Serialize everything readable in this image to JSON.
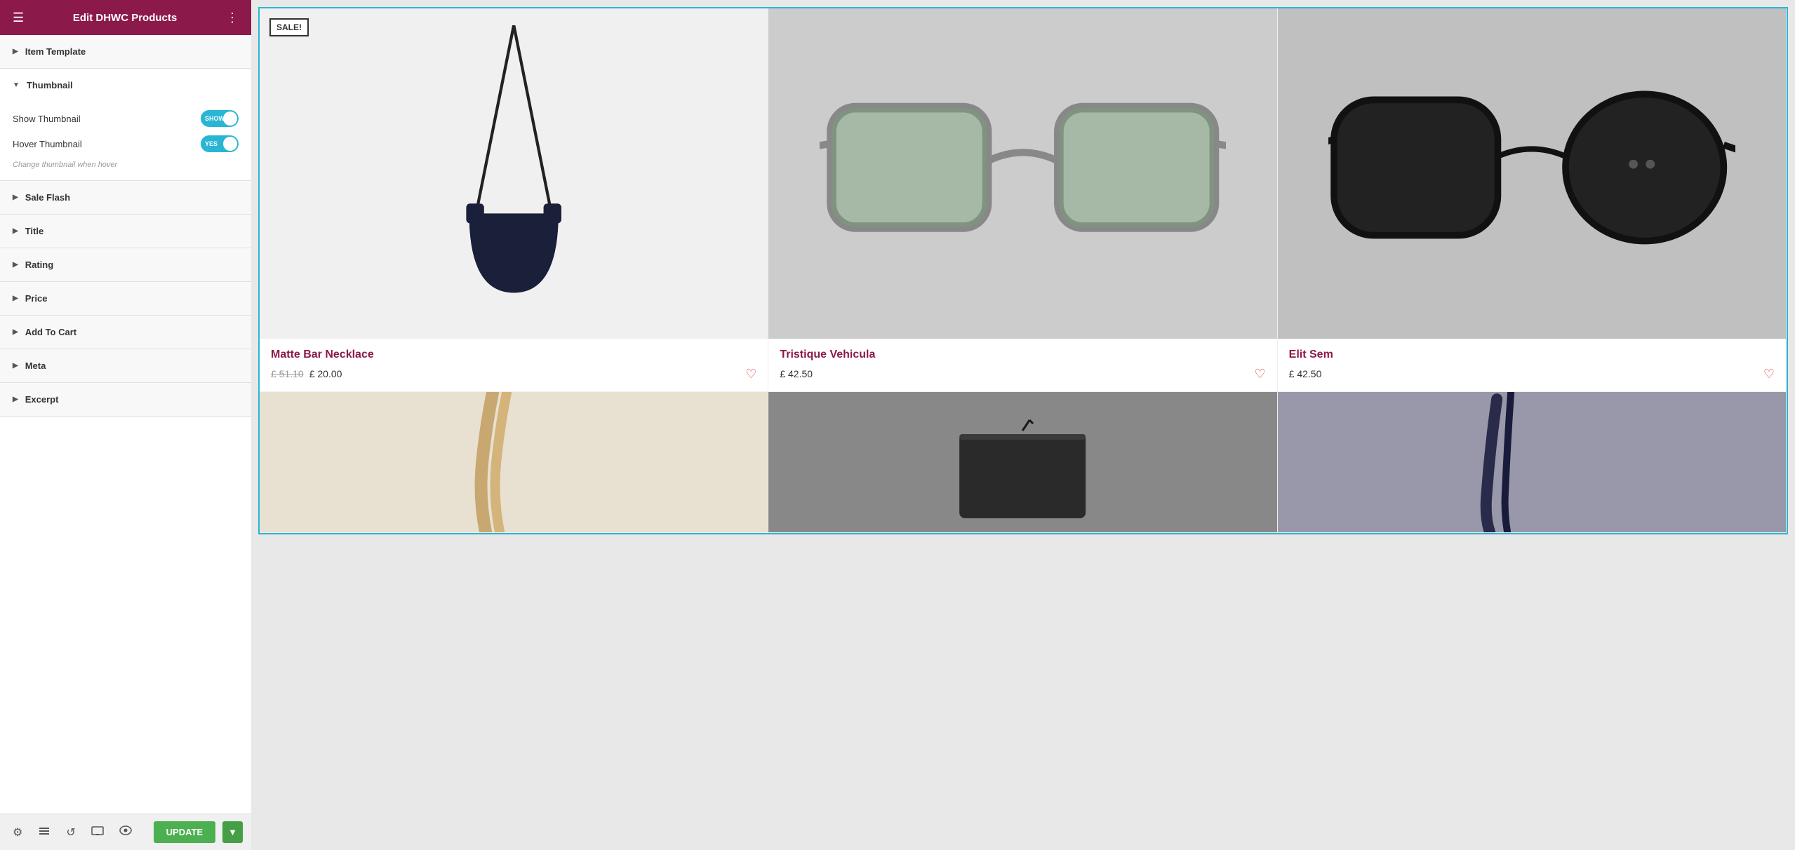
{
  "header": {
    "title": "Edit DHWC Products",
    "hamburger": "☰",
    "grid": "⋮⋮⋮"
  },
  "sidebar": {
    "item_template_label": "Item Template",
    "thumbnail_label": "Thumbnail",
    "show_thumbnail_label": "Show Thumbnail",
    "show_thumbnail_state": "SHOW",
    "show_thumbnail_on": true,
    "hover_thumbnail_label": "Hover Thumbnail",
    "hover_thumbnail_state": "YES",
    "hover_thumbnail_on": true,
    "hover_thumbnail_hint": "Change thumbnail when hover",
    "sale_flash_label": "Sale Flash",
    "title_label": "Title",
    "rating_label": "Rating",
    "price_label": "Price",
    "add_to_cart_label": "Add To Cart",
    "meta_label": "Meta",
    "excerpt_label": "Excerpt"
  },
  "footer": {
    "update_label": "UPDATE",
    "settings_icon": "⚙",
    "layers_icon": "❑",
    "history_icon": "↺",
    "responsive_icon": "⬜",
    "eye_icon": "👁"
  },
  "products": [
    {
      "title": "Matte Bar Necklace",
      "price_old": "£ 51.10",
      "price_new": "£ 20.00",
      "has_sale": true,
      "type": "necklace"
    },
    {
      "title": "Tristique Vehicula",
      "price_old": "",
      "price_new": "£ 42.50",
      "has_sale": false,
      "type": "sunglasses_clear"
    },
    {
      "title": "Elit Sem",
      "price_old": "",
      "price_new": "£ 42.50",
      "has_sale": false,
      "type": "sunglasses_black"
    }
  ]
}
